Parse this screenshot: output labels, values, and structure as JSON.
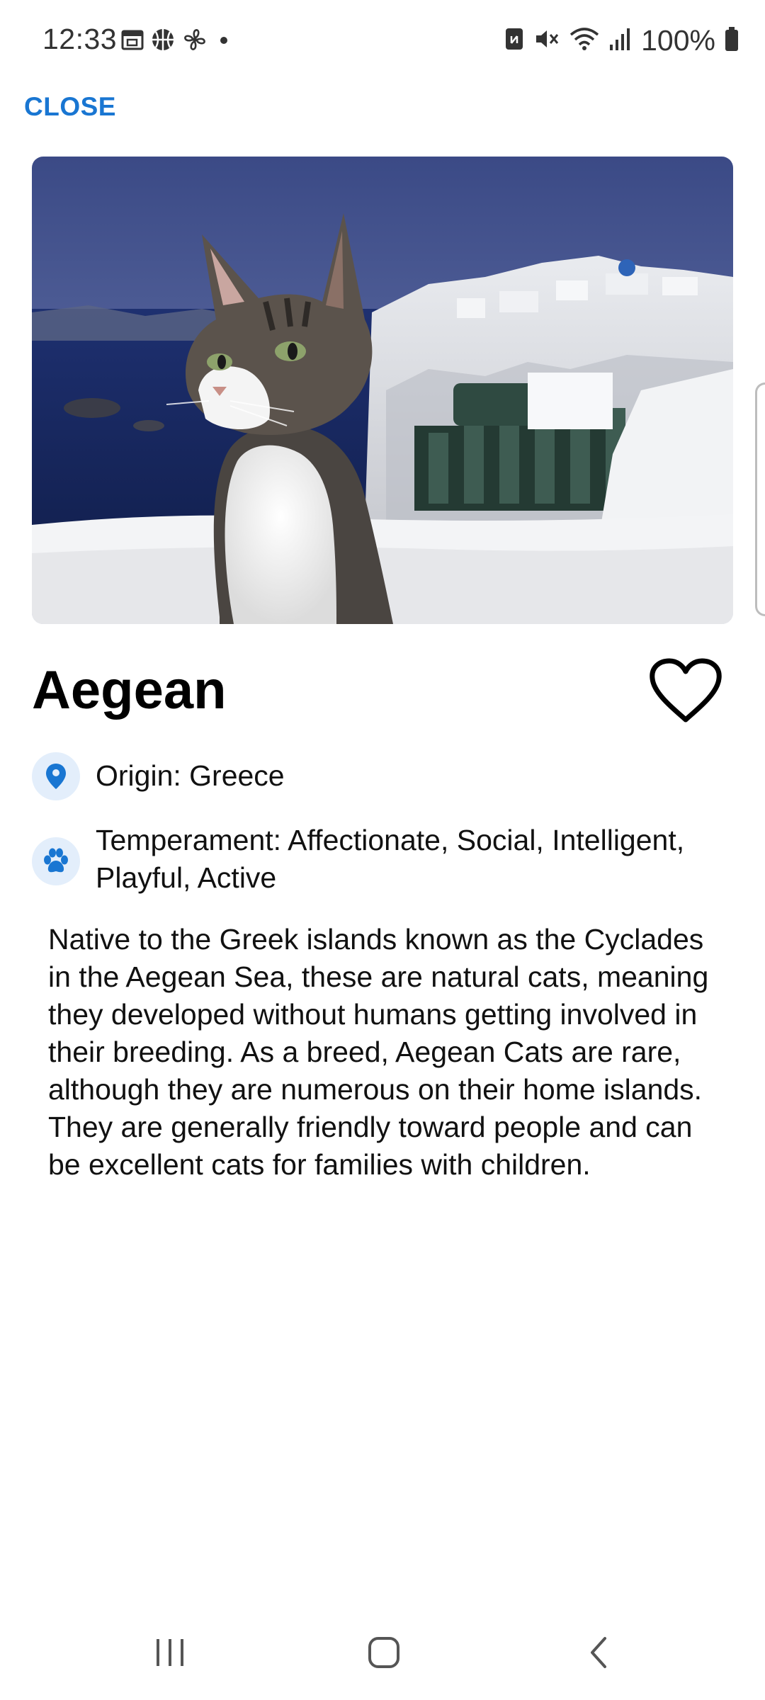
{
  "status_bar": {
    "time": "12:33",
    "left_icons": [
      "calendar-icon",
      "basketball-icon",
      "fan-icon",
      "dot-icon"
    ],
    "right_icons": [
      "nfc-icon",
      "mute-icon",
      "wifi-icon",
      "signal-icon",
      "battery-icon"
    ],
    "battery_text": "100%"
  },
  "header": {
    "close_label": "CLOSE",
    "accent_color": "#1976d2"
  },
  "breed": {
    "name": "Aegean",
    "image_icon": "cat-photo",
    "favorite_icon": "heart-outline-icon",
    "origin_text": "Origin: Greece",
    "origin_icon": "location-pin-icon",
    "temperament_text": "Temperament: Affectionate, Social, Intelligent, Playful, Active",
    "temperament_icon": "paw-icon",
    "description": "Native to the Greek islands known as the Cyclades in the Aegean Sea, these are natural cats, meaning they developed without humans getting involved in their breeding. As a breed, Aegean Cats are rare, although they are numerous on their home islands. They are generally friendly toward people and can be excellent cats for families with children."
  },
  "nav_bar": {
    "buttons": [
      "recents-icon",
      "home-icon",
      "back-icon"
    ]
  }
}
